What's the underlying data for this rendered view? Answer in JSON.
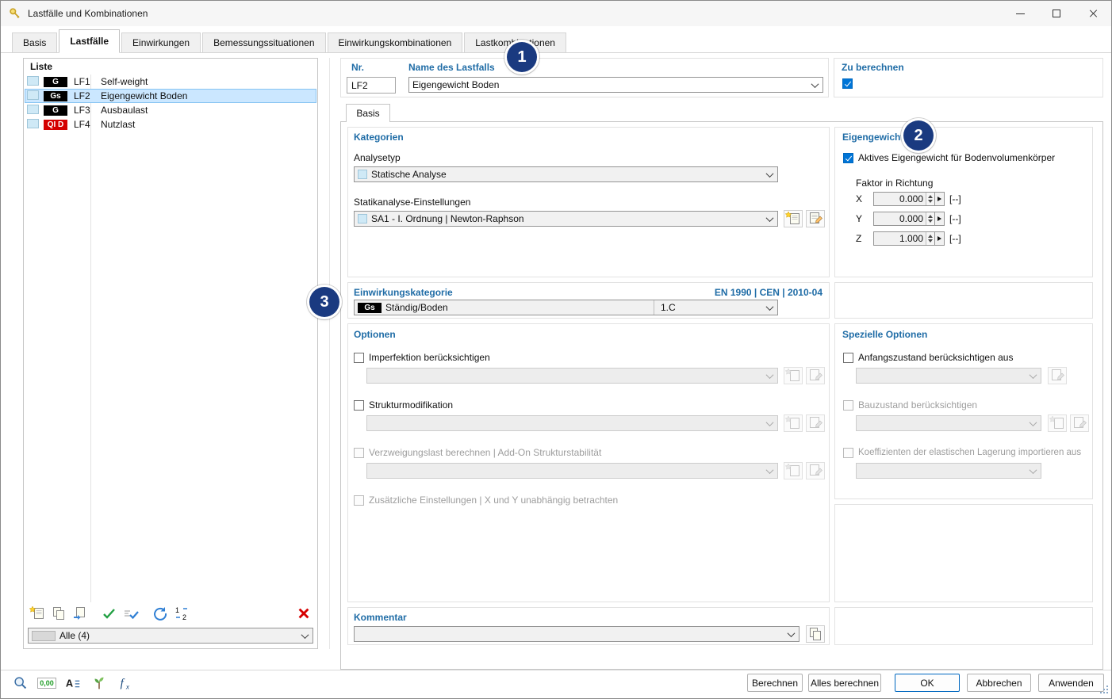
{
  "window": {
    "title": "Lastfälle und Kombinationen"
  },
  "tabs": [
    "Basis",
    "Lastfälle",
    "Einwirkungen",
    "Bemessungssituationen",
    "Einwirkungskombinationen",
    "Lastkombinationen"
  ],
  "active_tab": "Lastfälle",
  "list_panel": {
    "title": "Liste",
    "items": [
      {
        "badge": "G",
        "id": "LF1",
        "name": "Self-weight"
      },
      {
        "badge": "Gs",
        "id": "LF2",
        "name": "Eigengewicht Boden"
      },
      {
        "badge": "G",
        "id": "LF3",
        "name": "Ausbaulast"
      },
      {
        "badge": "QI D",
        "id": "LF4",
        "name": "Nutzlast"
      }
    ],
    "selected_id": "LF2",
    "filter_value": "Alle (4)"
  },
  "header": {
    "nr_label": "Nr.",
    "nr_value": "LF2",
    "name_label": "Name des Lastfalls",
    "name_value": "Eigengewicht Boden",
    "calc_label": "Zu berechnen",
    "calc_checked": true
  },
  "basis_tab_label": "Basis",
  "kategorien": {
    "title": "Kategorien",
    "analysetyp_label": "Analysetyp",
    "analysetyp_value": "Statische Analyse",
    "statik_label": "Statikanalyse-Einstellungen",
    "statik_value": "SA1 - I. Ordnung | Newton-Raphson"
  },
  "eigengewicht": {
    "title": "Eigengewicht",
    "aktiv_label": "Aktives Eigengewicht für Bodenvolumenkörper",
    "aktiv_checked": true,
    "faktor_label": "Faktor in Richtung",
    "rows": [
      {
        "axis": "X",
        "value": "0.000",
        "unit": "[--]"
      },
      {
        "axis": "Y",
        "value": "0.000",
        "unit": "[--]"
      },
      {
        "axis": "Z",
        "value": "1.000",
        "unit": "[--]"
      }
    ]
  },
  "einwirkungskategorie": {
    "title": "Einwirkungskategorie",
    "norm": "EN 1990 | CEN | 2010-04",
    "badge": "Gs",
    "value": "Ständig/Boden",
    "code": "1.C"
  },
  "optionen": {
    "title": "Optionen",
    "imperfektion": "Imperfektion berücksichtigen",
    "strukturmod": "Strukturmodifikation",
    "verzweigung": "Verzweigungslast berechnen | Add-On Strukturstabilität",
    "zusatz": "Zusätzliche Einstellungen | X und Y unabhängig betrachten"
  },
  "spezielle": {
    "title": "Spezielle Optionen",
    "anfang": "Anfangszustand berücksichtigen aus",
    "bau": "Bauzustand berücksichtigen",
    "koeff": "Koeffizienten der elastischen Lagerung importieren aus"
  },
  "kommentar": {
    "title": "Kommentar"
  },
  "footer": {
    "berechnen": "Berechnen",
    "alles_berechnen": "Alles berechnen",
    "ok": "OK",
    "abbrechen": "Abbrechen",
    "anwenden": "Anwenden"
  },
  "statusbar": {
    "decimal_display": "0,00"
  },
  "annotations": [
    "1",
    "2",
    "3"
  ],
  "colors": {
    "header_blue": "#1f6ca6",
    "selection_bg": "#cbe7ff",
    "badge_black": "#000000",
    "badge_red": "#d40000",
    "checkbox_blue": "#0075d7",
    "annotation_navy": "#1a3a80",
    "ok_border": "#0067c0"
  },
  "icons": {
    "statusbar": [
      "find-icon",
      "decimal-places-icon",
      "units-icon",
      "display-options-icon",
      "formula-icon"
    ]
  }
}
